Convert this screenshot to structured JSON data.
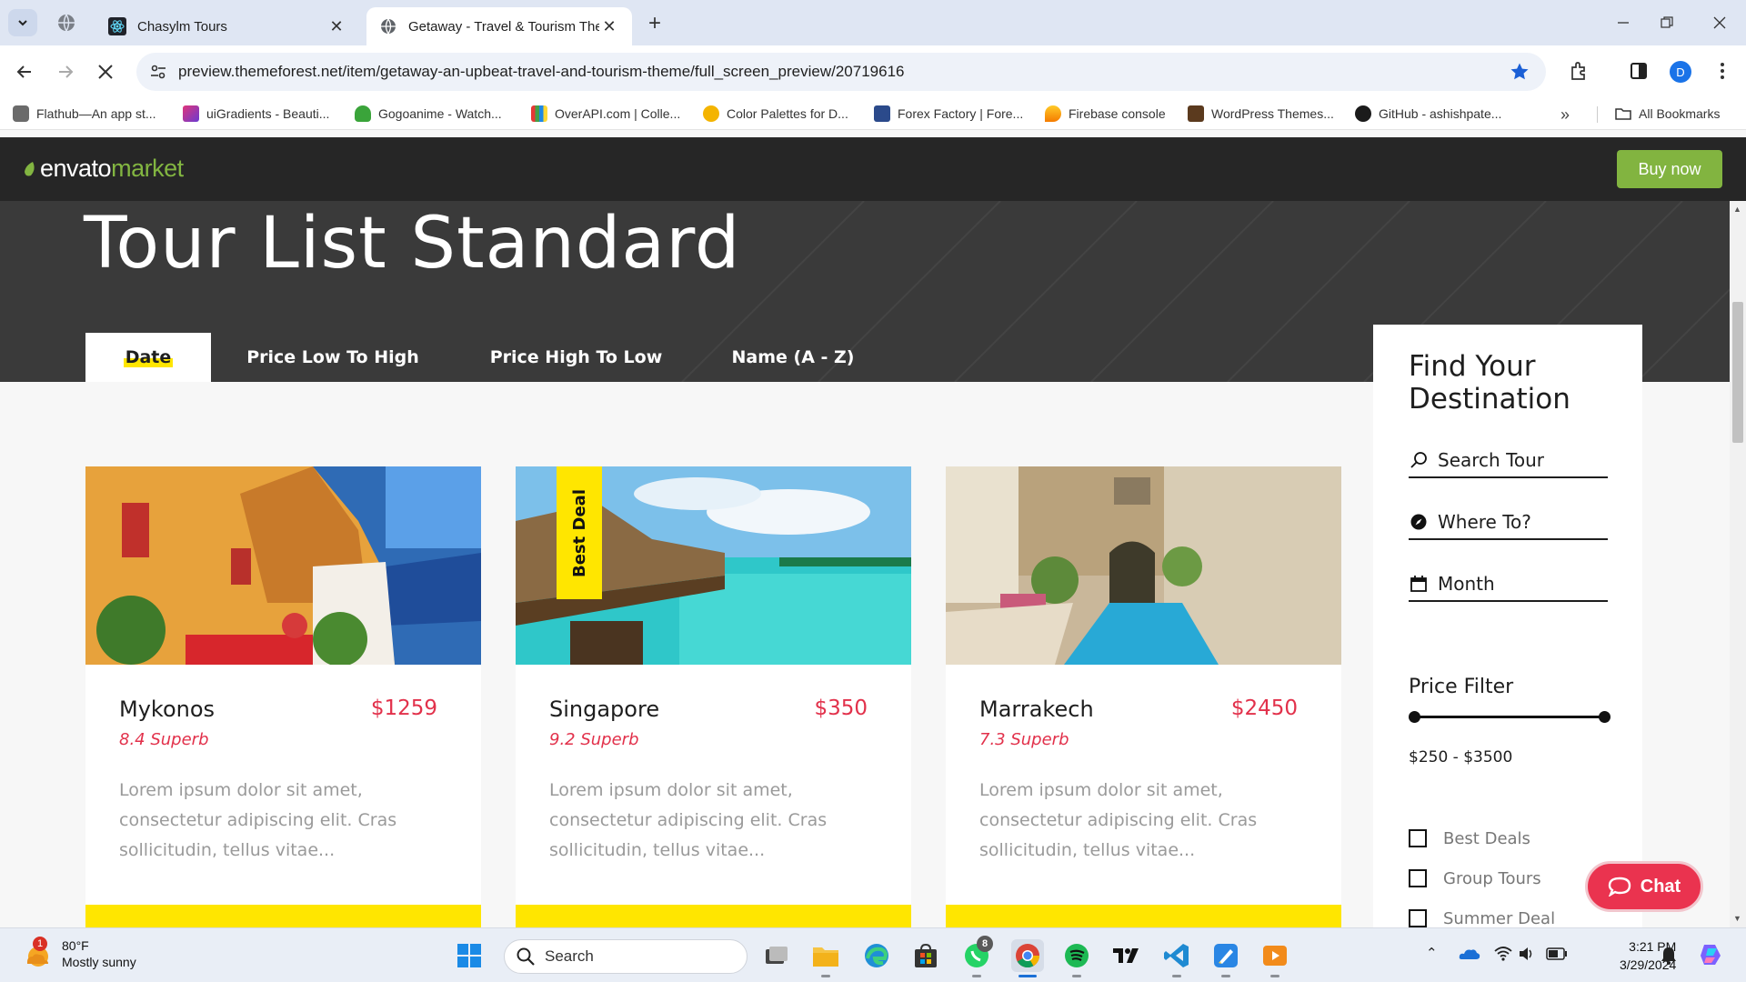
{
  "browser": {
    "tabs": [
      {
        "title": "Chasylm Tours"
      },
      {
        "title": "Getaway - Travel & Tourism The"
      }
    ],
    "url": "preview.themeforest.net/item/getaway-an-upbeat-travel-and-tourism-theme/full_screen_preview/20719616",
    "profile_initial": "D",
    "bookmarks": [
      "Flathub—An app st...",
      "uiGradients - Beauti...",
      "Gogoanime - Watch...",
      "OverAPI.com | Colle...",
      "Color Palettes for D...",
      "Forex Factory | Fore...",
      "Firebase console",
      "WordPress Themes...",
      "GitHub - ashishpate..."
    ],
    "all_bookmarks": "All Bookmarks"
  },
  "envato": {
    "logo_main": "envato",
    "logo_accent": "market",
    "buy_now": "Buy now"
  },
  "page": {
    "title": "Tour List Standard",
    "sort_tabs": [
      "Date",
      "Price Low To High",
      "Price High To Low",
      "Name (A - Z)"
    ],
    "tours": [
      {
        "name": "Mykonos",
        "price": "$1259",
        "rating": "8.4 Superb",
        "desc": "Lorem ipsum dolor sit amet, consectetur adipiscing elit. Cras sollicitudin, tellus vitae...",
        "badge": ""
      },
      {
        "name": "Singapore",
        "price": "$350",
        "rating": "9.2 Superb",
        "desc": "Lorem ipsum dolor sit amet, consectetur adipiscing elit. Cras sollicitudin, tellus vitae...",
        "badge": "Best Deal"
      },
      {
        "name": "Marrakech",
        "price": "$2450",
        "rating": "7.3 Superb",
        "desc": "Lorem ipsum dolor sit amet, consectetur adipiscing elit. Cras sollicitudin, tellus vitae...",
        "badge": ""
      }
    ],
    "sidebar": {
      "title": "Find Your Destination",
      "search_placeholder": "Search Tour",
      "where_placeholder": "Where To?",
      "month_placeholder": "Month",
      "price_filter_label": "Price Filter",
      "price_range": "$250 - $3500",
      "checkboxes": [
        "Best Deals",
        "Group Tours",
        "Summer Deal"
      ]
    },
    "chat_label": "Chat"
  },
  "taskbar": {
    "weather_temp": "80°F",
    "weather_desc": "Mostly sunny",
    "weather_alert": "1",
    "search_label": "Search",
    "whatsapp_badge": "8",
    "time": "3:21 PM",
    "date": "3/29/2024"
  },
  "colors": {
    "accent_yellow": "#ffe600",
    "price_red": "#e2314b",
    "envato_green": "#82b440",
    "hero_dark": "#3a3a3a",
    "chat_red": "#ea334f"
  }
}
